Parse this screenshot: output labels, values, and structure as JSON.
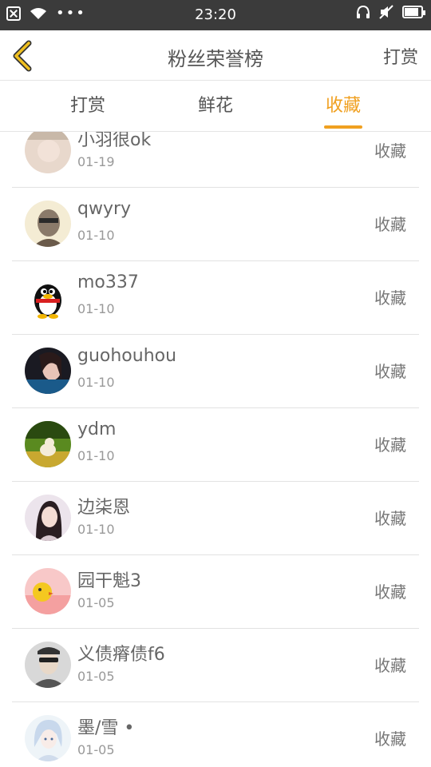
{
  "status_bar": {
    "time": "23:20",
    "dots": "•••",
    "battery_level": 0.85
  },
  "nav": {
    "title": "粉丝荣誉榜",
    "action": "打赏",
    "back_icon": "chevron-left-icon",
    "accent_color": "#f0a020"
  },
  "tabs": [
    {
      "label": "打赏",
      "active": false
    },
    {
      "label": "鲜花",
      "active": false
    },
    {
      "label": "收藏",
      "active": true
    }
  ],
  "items": [
    {
      "name": "小羽很ok",
      "date": "01-19",
      "action": "收藏"
    },
    {
      "name": "qwyry",
      "date": "01-10",
      "action": "收藏"
    },
    {
      "name": "mo337",
      "date": "01-10",
      "action": "收藏"
    },
    {
      "name": "guohouhou",
      "date": "01-10",
      "action": "收藏"
    },
    {
      "name": "ydm",
      "date": "01-10",
      "action": "收藏"
    },
    {
      "name": "边柒恩",
      "date": "01-10",
      "action": "收藏"
    },
    {
      "name": "园干魁3",
      "date": "01-05",
      "action": "收藏"
    },
    {
      "name": "义债瘠债f6",
      "date": "01-05",
      "action": "收藏"
    },
    {
      "name": "墨/雪 •",
      "date": "01-05",
      "action": "收藏"
    }
  ]
}
